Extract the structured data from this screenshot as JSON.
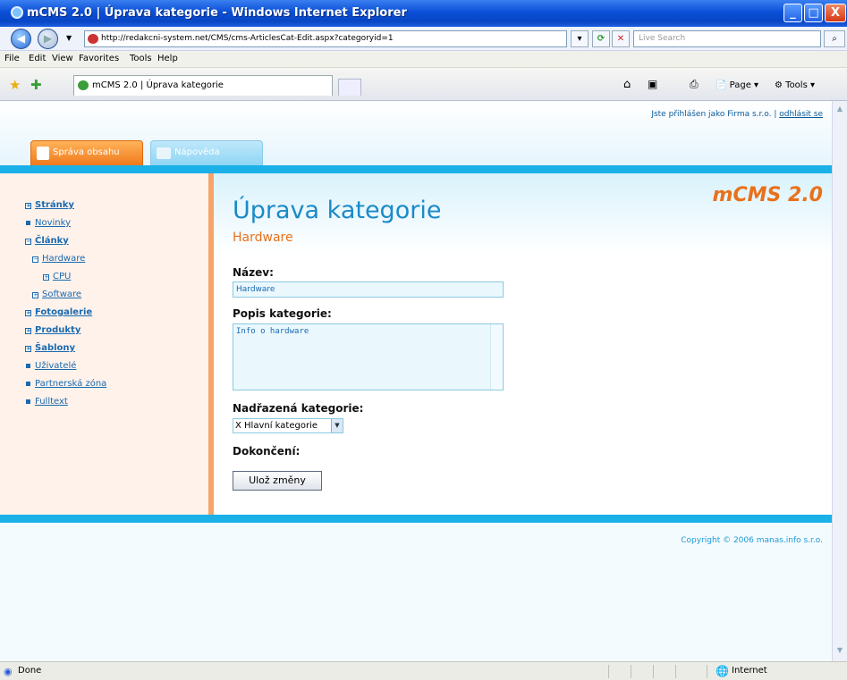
{
  "window": {
    "title": "mCMS 2.0 | Úprava kategorie - Windows Internet Explorer",
    "minimize": "_",
    "maximize": "□",
    "close": "X"
  },
  "address_bar": {
    "url": "http://redakcni-system.net/CMS/cms-ArticlesCat-Edit.aspx?categoryid=1",
    "search_placeholder": "Live Search"
  },
  "menu": [
    "File",
    "Edit",
    "View",
    "Favorites",
    "Tools",
    "Help"
  ],
  "browser_tab": {
    "label": "mCMS 2.0 | Úprava kategorie"
  },
  "toolbar": {
    "page_label": "Page",
    "tools_label": "Tools"
  },
  "header": {
    "logged_in_text": "Jste přihlášen jako Firma s.r.o. |",
    "logout_link": "odhlásit se",
    "tab_content": "Správa obsahu",
    "tab_help": "Nápověda",
    "logo": "mCMS 2.0"
  },
  "sidebar": {
    "items": [
      {
        "label": "Stránky",
        "bold": true
      },
      {
        "label": "Novinky",
        "bold": false
      },
      {
        "label": "Články",
        "bold": true
      },
      {
        "label": "Hardware",
        "bold": false
      },
      {
        "label": "CPU",
        "bold": false
      },
      {
        "label": "Software",
        "bold": false
      },
      {
        "label": "Fotogalerie",
        "bold": true
      },
      {
        "label": "Produkty",
        "bold": true
      },
      {
        "label": "Šablony",
        "bold": true
      },
      {
        "label": "Uživatelé",
        "bold": false
      },
      {
        "label": "Partnerská zóna",
        "bold": false
      },
      {
        "label": "Fulltext",
        "bold": false
      }
    ]
  },
  "form": {
    "title": "Úprava kategorie",
    "subtitle": "Hardware",
    "name_label": "Název:",
    "name_value": "Hardware",
    "description_label": "Popis kategorie:",
    "description_value": "Info o hardware",
    "parent_label": "Nadřazená kategorie:",
    "parent_value": "X Hlavní kategorie",
    "finish_label": "Dokončení:",
    "save_button": "Ulož změny"
  },
  "footer": {
    "copyright": "Copyright © 2006 manas.info s.r.o."
  },
  "statusbar": {
    "status": "Done",
    "zone": "Internet"
  },
  "colors": {
    "accent_blue": "#1ab0e8",
    "accent_orange": "#e8711a",
    "link_blue": "#1a6ab0"
  }
}
